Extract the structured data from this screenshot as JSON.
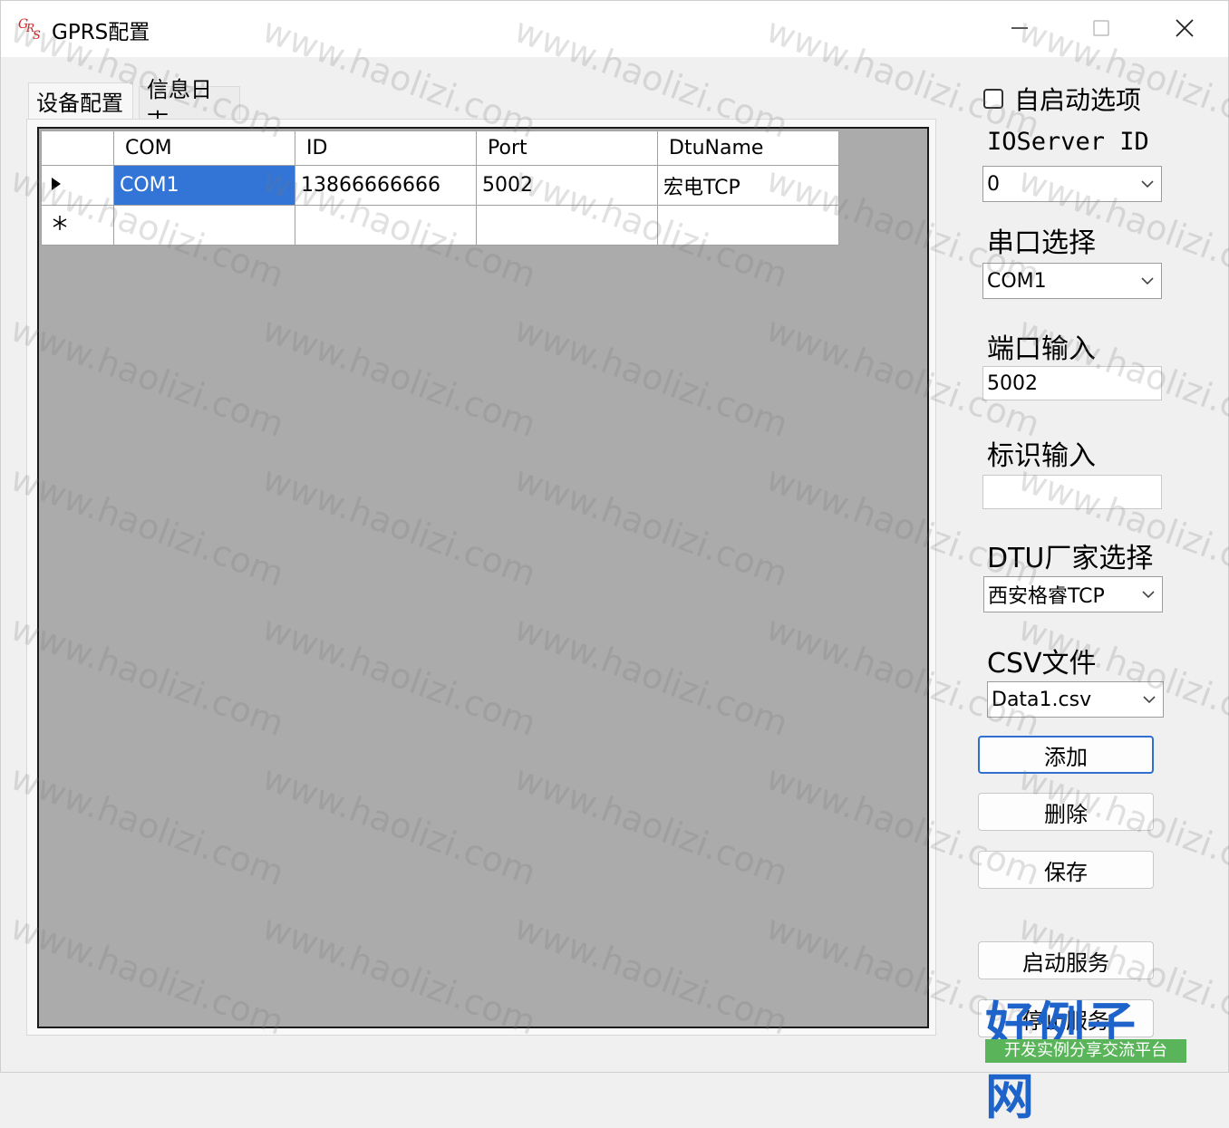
{
  "window": {
    "title": "GPRS配置",
    "controls": {
      "minimize": "minimize",
      "maximize": "maximize",
      "close": "close"
    }
  },
  "tabs": [
    {
      "label": "设备配置",
      "active": true
    },
    {
      "label": "信息日志",
      "active": false
    }
  ],
  "grid": {
    "columns": [
      "COM",
      "ID",
      "Port",
      "DtuName"
    ],
    "rows": [
      {
        "marker": "▶",
        "cells": [
          "COM1",
          "13866666666",
          "5002",
          "宏电TCP"
        ],
        "selected_cell": 0
      },
      {
        "marker": "✳",
        "cells": [
          "",
          "",
          "",
          ""
        ]
      }
    ]
  },
  "side": {
    "autostart_label": "自启动选项",
    "autostart_checked": false,
    "ioserver_label": "IOServer ID",
    "ioserver_value": "0",
    "serial_label": "串口选择",
    "serial_value": "COM1",
    "port_label": "端口输入",
    "port_value": "5002",
    "ident_label": "标识输入",
    "ident_value": "",
    "dtu_label": "DTU厂家选择",
    "dtu_value": "西安格睿TCP",
    "csv_label": "CSV文件",
    "csv_value": "Data1.csv",
    "buttons": {
      "add": "添加",
      "delete": "删除",
      "save": "保存",
      "start": "启动服务",
      "stop": "停止服务"
    }
  },
  "watermark": {
    "text": "www.haolizi.com",
    "logo_main": "好例子网",
    "logo_sub": "开发实例分享交流平台"
  },
  "colors": {
    "selection": "#3375d6",
    "grid_background": "#ababab",
    "default_button_border": "#2f6fd0",
    "logo_blue": "#1e63c9",
    "logo_green": "#5ab55a"
  }
}
